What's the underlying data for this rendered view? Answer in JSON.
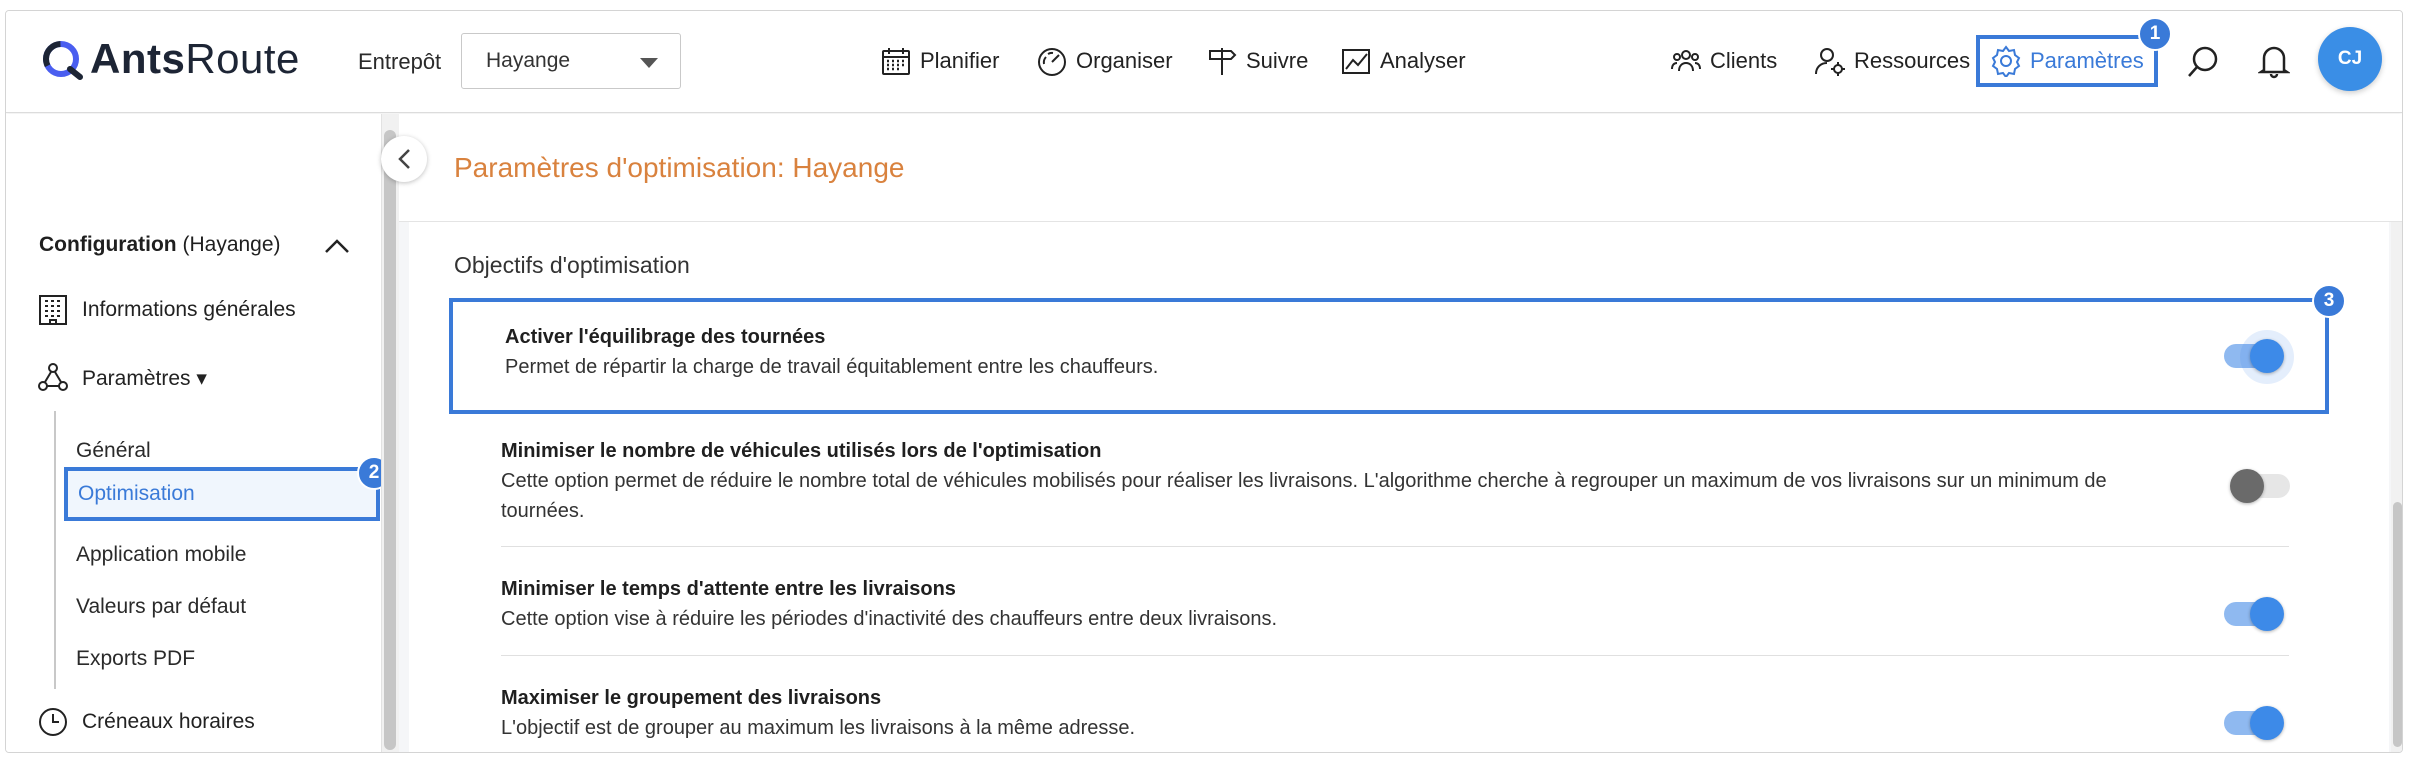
{
  "header": {
    "logo_bold": "Ants",
    "logo_light": "Route",
    "warehouse_label": "Entrepôt",
    "warehouse_value": "Hayange",
    "nav": [
      {
        "label": "Planifier",
        "icon": "calendar-icon"
      },
      {
        "label": "Organiser",
        "icon": "gauge-icon"
      },
      {
        "label": "Suivre",
        "icon": "signpost-icon"
      },
      {
        "label": "Analyser",
        "icon": "chart-icon"
      }
    ],
    "right_nav": [
      {
        "label": "Clients",
        "icon": "users-icon"
      },
      {
        "label": "Ressources",
        "icon": "user-gear-icon"
      },
      {
        "label": "Paramètres",
        "icon": "gear-icon"
      }
    ],
    "avatar_initials": "CJ",
    "accent_color": "#3a7ad8"
  },
  "badges": {
    "b1": "1",
    "b2": "2",
    "b3": "3"
  },
  "sidebar": {
    "config_label": "Configuration",
    "config_suffix": "(Hayange)",
    "info_label": "Informations générales",
    "params_label": "Paramètres ▾",
    "sub_items": [
      "Général",
      "Optimisation",
      "Application mobile",
      "Valeurs par défaut",
      "Exports PDF"
    ],
    "time_slots_label": "Créneaux horaires"
  },
  "main": {
    "title": "Paramètres d'optimisation: Hayange",
    "title_color": "#d9823e",
    "section_title": "Objectifs d'optimisation",
    "options": [
      {
        "title": "Activer l'équilibrage des tournées",
        "description": "Permet de répartir la charge de travail équitablement entre les chauffeurs.",
        "enabled": true
      },
      {
        "title": "Minimiser le nombre de véhicules utilisés lors de l'optimisation",
        "description": "Cette option permet de réduire le nombre total de véhicules mobilisés pour réaliser les livraisons. L'algorithme cherche à regrouper un maximum de vos livraisons sur un minimum de tournées.",
        "enabled": false
      },
      {
        "title": "Minimiser le temps d'attente entre les livraisons",
        "description": "Cette option vise à réduire les périodes d'inactivité des chauffeurs entre deux livraisons.",
        "enabled": true
      },
      {
        "title": "Maximiser le groupement des livraisons",
        "description": "L'objectif est de grouper au maximum les livraisons à la même adresse.",
        "enabled": true
      }
    ]
  }
}
